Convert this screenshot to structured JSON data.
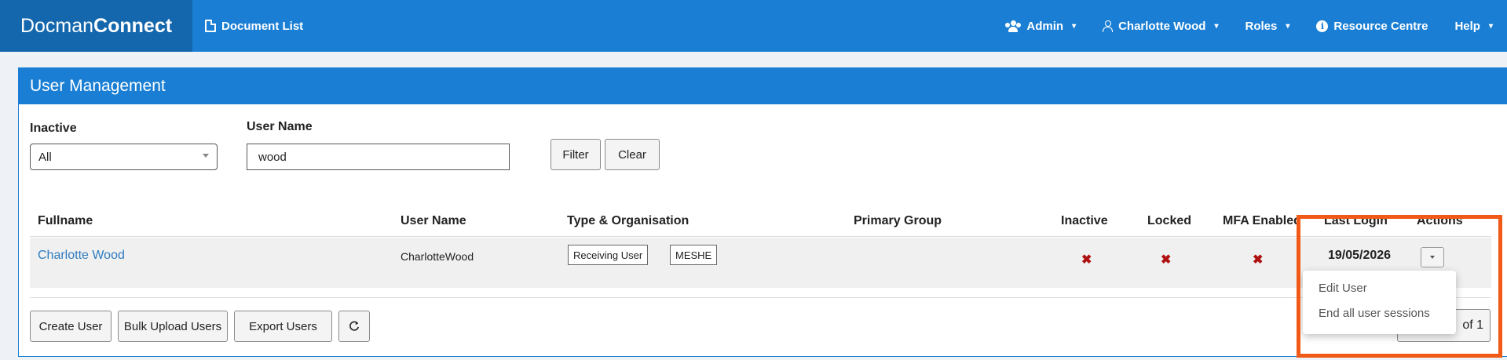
{
  "navbar": {
    "brand_prefix": "Docman",
    "brand_suffix": "Connect",
    "document_list": "Document List",
    "admin": "Admin",
    "user": "Charlotte Wood",
    "roles": "Roles",
    "resource_centre": "Resource Centre",
    "help": "Help",
    "caret": "▾"
  },
  "panel": {
    "title": "User Management"
  },
  "filters": {
    "inactive_label": "Inactive",
    "inactive_value": "All",
    "username_label": "User Name",
    "username_value": "wood",
    "filter_button": "Filter",
    "clear_button": "Clear"
  },
  "table": {
    "columns": [
      "Fullname",
      "User Name",
      "Type & Organisation",
      "Primary Group",
      "Inactive",
      "Locked",
      "MFA Enabled",
      "Last Login",
      "Actions"
    ],
    "rows": [
      {
        "fullname": "Charlotte Wood",
        "username": "CharlotteWood",
        "type": "Receiving User",
        "organisation": "MESHE",
        "primary_group": "",
        "inactive": "✖",
        "locked": "✖",
        "mfa_enabled": "✖",
        "last_login": "19/05/2026"
      }
    ]
  },
  "footer": {
    "create_user": "Create User",
    "bulk_upload": "Bulk Upload Users",
    "export_users": "Export Users",
    "pager_text": "of 1"
  },
  "actions_menu": {
    "edit_user": "Edit User",
    "end_sessions": "End all user sessions"
  },
  "colors": {
    "navbar": "#1a7fd4",
    "brand": "#1567ad",
    "highlight": "#f05a16",
    "x_mark": "#b01010",
    "link": "#2f7bbf"
  }
}
